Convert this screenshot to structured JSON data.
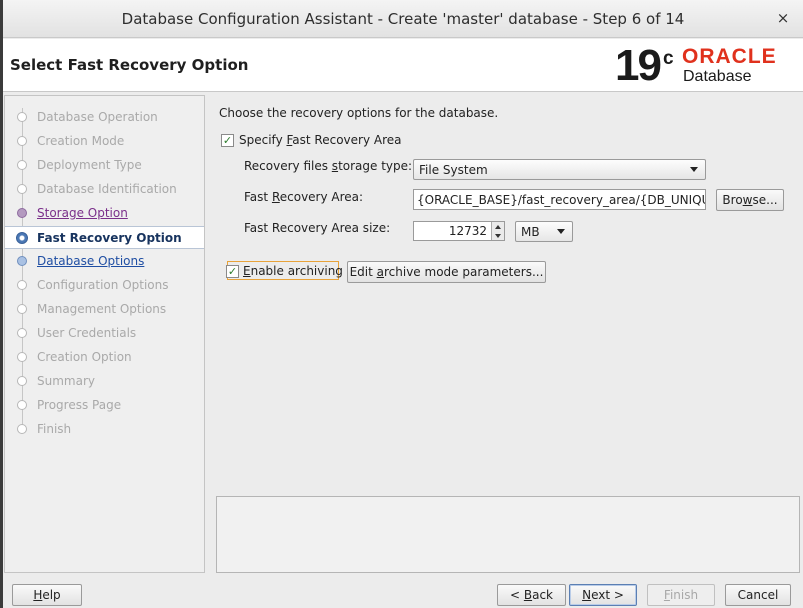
{
  "window": {
    "title": "Database Configuration Assistant - Create 'master' database - Step 6 of 14",
    "close_glyph": "×"
  },
  "header": {
    "page_title": "Select Fast Recovery Option",
    "logo": {
      "version": "19",
      "version_suffix": "c",
      "brand": "ORACLE",
      "product": "Database"
    }
  },
  "nav": {
    "items": [
      {
        "label": "Database Operation",
        "state": "pending"
      },
      {
        "label": "Creation Mode",
        "state": "pending"
      },
      {
        "label": "Deployment Type",
        "state": "pending"
      },
      {
        "label": "Database Identification",
        "state": "pending"
      },
      {
        "label": "Storage Option",
        "state": "visited"
      },
      {
        "label": "Fast Recovery Option",
        "state": "current"
      },
      {
        "label": "Database Options",
        "state": "link"
      },
      {
        "label": "Configuration Options",
        "state": "pending"
      },
      {
        "label": "Management Options",
        "state": "pending"
      },
      {
        "label": "User Credentials",
        "state": "pending"
      },
      {
        "label": "Creation Option",
        "state": "pending"
      },
      {
        "label": "Summary",
        "state": "pending"
      },
      {
        "label": "Progress Page",
        "state": "pending"
      },
      {
        "label": "Finish",
        "state": "pending"
      }
    ]
  },
  "content": {
    "intro": "Choose the recovery options for the database.",
    "specify_fra": {
      "pre": "Specify ",
      "accel": "F",
      "post": "ast Recovery Area",
      "checked": true
    },
    "storage_type": {
      "label_pre": "Recovery files ",
      "label_accel": "s",
      "label_post": "torage type:",
      "value": "File System"
    },
    "fra_location": {
      "label_pre": "Fast ",
      "label_accel": "R",
      "label_post": "ecovery Area:",
      "value": "{ORACLE_BASE}/fast_recovery_area/{DB_UNIQUE_",
      "browse_pre": "Bro",
      "browse_accel": "w",
      "browse_post": "se..."
    },
    "fra_size": {
      "label": "Fast Recovery Area size:",
      "value": "12732",
      "unit": "MB"
    },
    "enable_archiving": {
      "pre": "",
      "accel": "E",
      "post": "nable archiving",
      "checked": true
    },
    "edit_archive": {
      "pre": "Edit ",
      "accel": "a",
      "post": "rchive mode parameters..."
    },
    "message": ""
  },
  "footer": {
    "help": {
      "accel": "H",
      "post": "elp"
    },
    "back": {
      "pre": "< ",
      "accel": "B",
      "post": "ack"
    },
    "next": {
      "accel": "N",
      "post": "ext >"
    },
    "finish": {
      "accel": "F",
      "post": "inish"
    },
    "cancel": "Cancel"
  },
  "colors": {
    "oracle_red": "#e0311d",
    "current_step_text": "#17335e",
    "link_text": "#1f4ea3",
    "visited_text": "#7a2f8a",
    "focus_highlight": "#e8a33a"
  },
  "icons": {
    "close": "close-icon",
    "checkbox": "checkmark-icon",
    "dropdown": "chevron-down-icon",
    "spinner": "spinner-arrows-icon"
  }
}
